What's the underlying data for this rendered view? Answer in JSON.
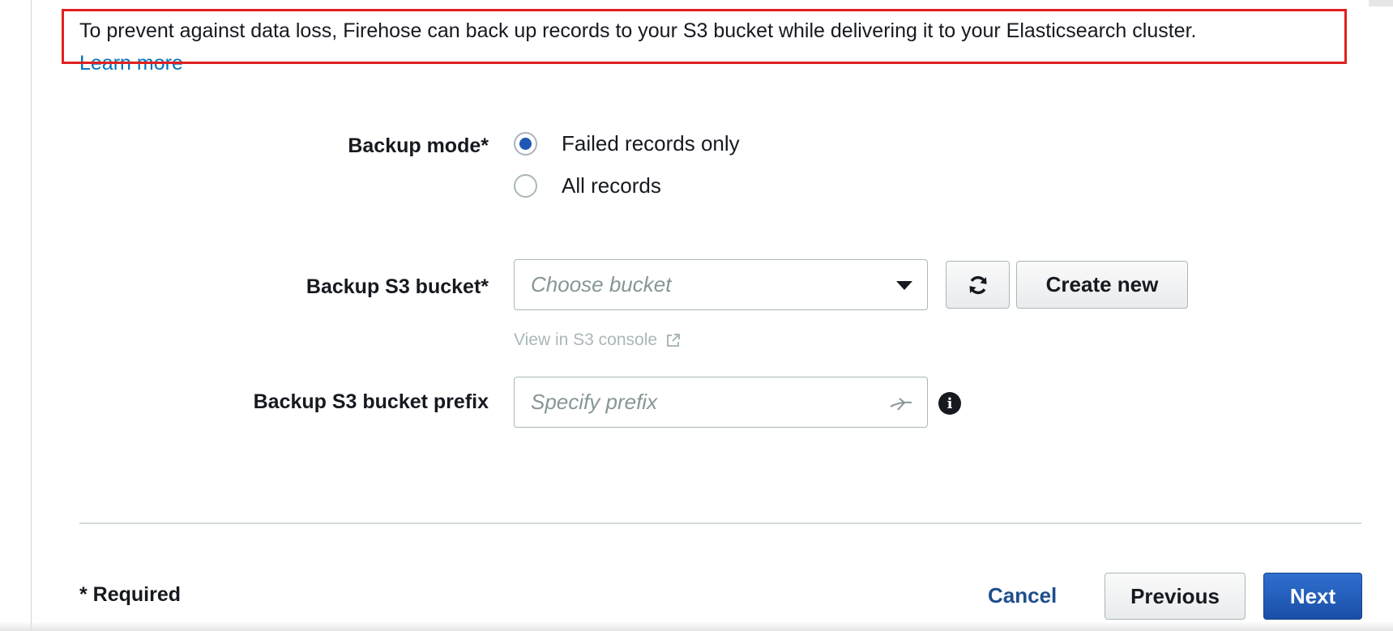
{
  "intro": {
    "text": "To prevent against data loss, Firehose can back up records to your S3 bucket while delivering it to your Elasticsearch cluster.",
    "learn_more": "Learn more"
  },
  "backup_mode": {
    "label": "Backup mode*",
    "options": [
      {
        "label": "Failed records only",
        "selected": true
      },
      {
        "label": "All records",
        "selected": false
      }
    ]
  },
  "backup_bucket": {
    "label": "Backup S3 bucket*",
    "placeholder": "Choose bucket",
    "value": "",
    "refresh_icon": "refresh-icon",
    "create_new_label": "Create new",
    "console_link": "View in S3 console"
  },
  "backup_prefix": {
    "label": "Backup S3 bucket prefix",
    "placeholder": "Specify prefix",
    "value": ""
  },
  "footer": {
    "required_note": "* Required",
    "cancel_label": "Cancel",
    "previous_label": "Previous",
    "next_label": "Next"
  },
  "colors": {
    "primary": "#1f58b4",
    "link": "#0073bb",
    "highlight": "#e02020"
  }
}
